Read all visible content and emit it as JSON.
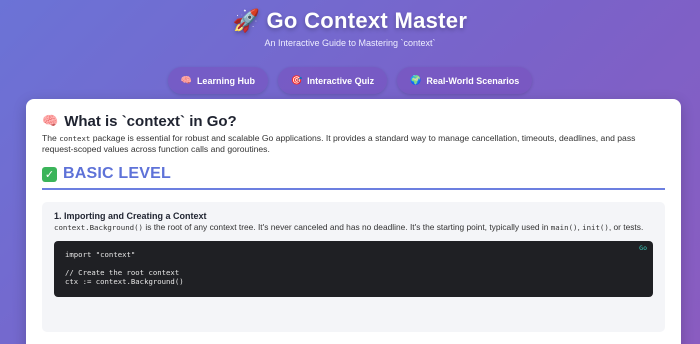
{
  "header": {
    "title_emoji": "🚀",
    "title": "Go Context Master",
    "subtitle": "An Interactive Guide to Mastering `context`"
  },
  "tabs": [
    {
      "icon": "brain-icon",
      "glyph": "🧠",
      "label": "Learning Hub"
    },
    {
      "icon": "target-icon",
      "glyph": "🎯",
      "label": "Interactive Quiz"
    },
    {
      "icon": "globe-icon",
      "glyph": "🌍",
      "label": "Real-World Scenarios"
    }
  ],
  "card": {
    "title_glyph": "🧠",
    "title": "What is `context` in Go?",
    "intro_pre": "The ",
    "intro_code": "context",
    "intro_post": " package is essential for robust and scalable Go applications. It provides a standard way to manage cancellation, timeouts, deadlines, and pass request-scoped values across function calls and goroutines."
  },
  "level": {
    "glyph": "✓",
    "label": "BASIC LEVEL",
    "accent": "#5e72d8"
  },
  "section": {
    "title": "1. Importing and Creating a Context",
    "desc_code1": "context.Background()",
    "desc_text1": " is the root of any context tree. It's never canceled and has no deadline. It's the starting point, typically used in ",
    "desc_code2": "main()",
    "desc_text2": ", ",
    "desc_code3": "init()",
    "desc_text3": ", or tests.",
    "code_lang": "Go",
    "code_lines": [
      "import \"context\"",
      "",
      "// Create the root context",
      "ctx := context.Background()"
    ]
  },
  "colors": {
    "background_start": "#6b73d6",
    "background_end": "#8a5cc0",
    "tab_bg": "#8a5cc0",
    "code_bg": "#1f2024",
    "code_lang": "#3dd1c0",
    "check_green": "#3bb45a"
  }
}
